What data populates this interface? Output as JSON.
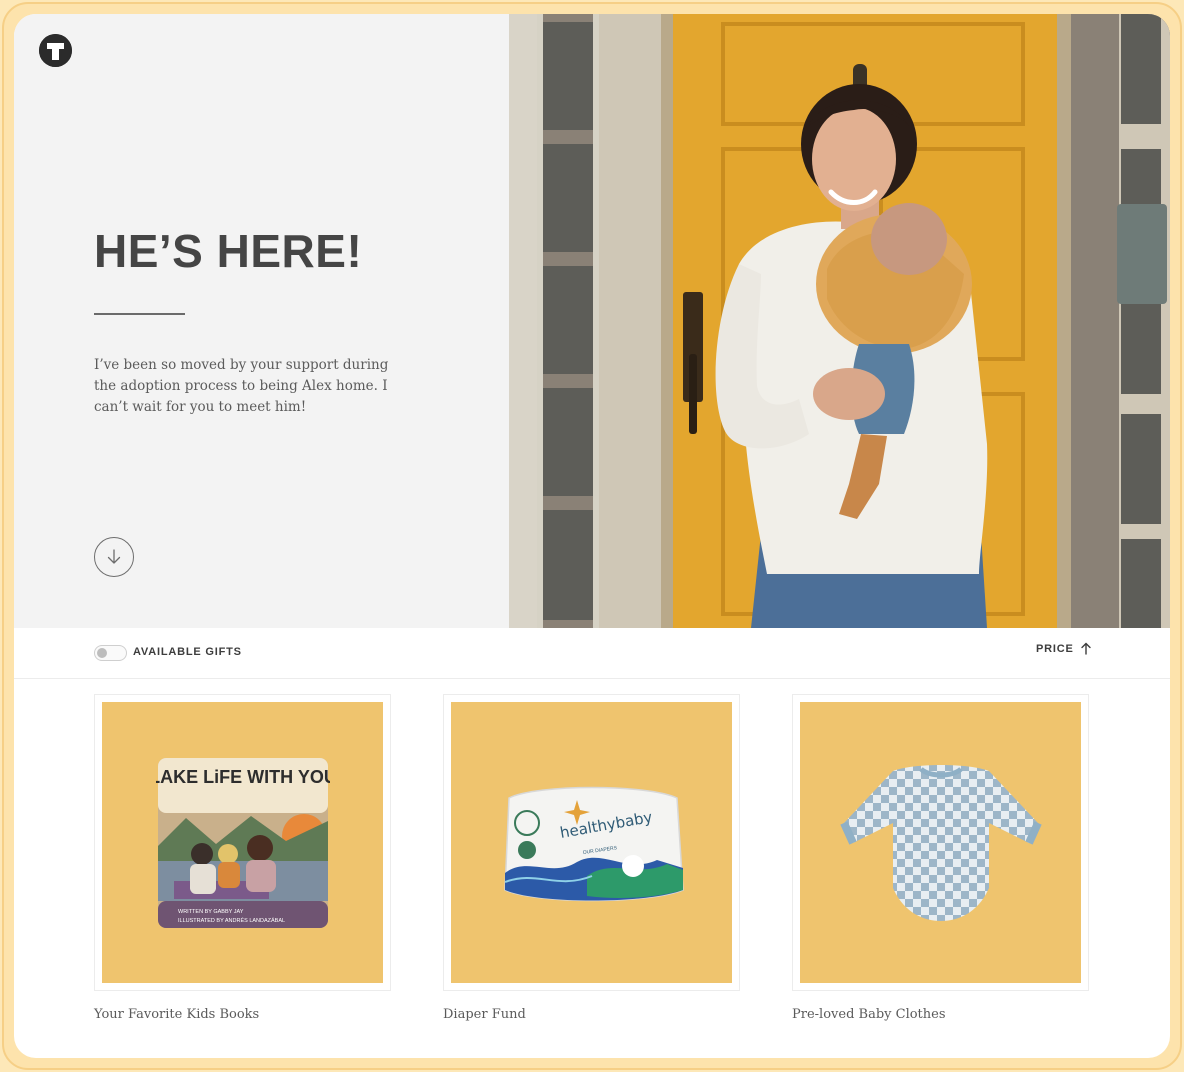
{
  "hero": {
    "logo_icon": "registry-logo-icon",
    "headline": "HE’S HERE!",
    "intro": "I’ve been so moved by your support during the adoption process to being Alex home. I can’t wait for you to meet him!",
    "scroll_icon": "arrow-down-circle-icon",
    "photo": "woman-holding-baby-photo"
  },
  "filter": {
    "toggle_label": "AVAILABLE GIFTS",
    "toggle_on": false,
    "sort_label": "PRICE",
    "sort_icon": "arrow-up-icon"
  },
  "gifts": [
    {
      "name": "Your Favorite Kids Books",
      "image": "book-cover-image",
      "book_title": "LAKE LiFE WITH YOU",
      "book_credit_1": "WRITTEN BY GABBY JAY",
      "book_credit_2": "ILLUSTRATED BY ANDRÉS LANDAZÁBAL"
    },
    {
      "name": "Diaper Fund",
      "image": "diaper-pack-image",
      "brand": "healthybaby",
      "pack_label": "OUR DIAPERS"
    },
    {
      "name": "Pre-loved Baby Clothes",
      "image": "checkered-onesie-image"
    }
  ],
  "colors": {
    "frame": "#fde3ac",
    "tile": "#efc46e",
    "hero_panel": "#f3f3f3",
    "door": "#e3a62e"
  }
}
